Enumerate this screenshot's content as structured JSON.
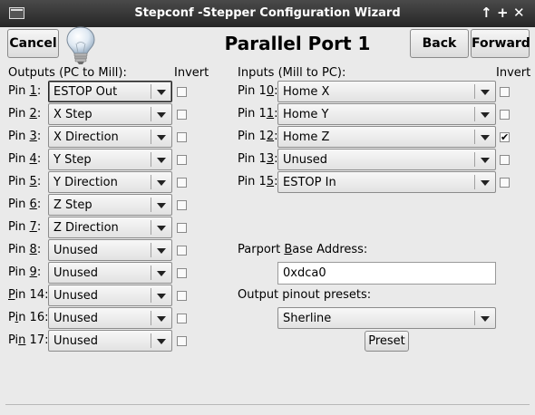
{
  "window": {
    "title": "Stepconf -Stepper Configuration Wizard"
  },
  "titlebar": {
    "restore_glyph": "↑",
    "maximize_glyph": "+",
    "close_glyph": "✕"
  },
  "toolbar": {
    "cancel_label": "Cancel",
    "back_label": "Back",
    "forward_label": "Forward"
  },
  "page": {
    "title": "Parallel Port 1"
  },
  "outputs": {
    "header": "Outputs (PC to Mill):",
    "invert_header": "Invert",
    "pins": [
      {
        "label_pre": "Pin ",
        "label_u": "1",
        "label_post": ":",
        "value": "ESTOP Out",
        "inverted": false
      },
      {
        "label_pre": "Pin ",
        "label_u": "2",
        "label_post": ":",
        "value": "X Step",
        "inverted": false
      },
      {
        "label_pre": "Pin ",
        "label_u": "3",
        "label_post": ":",
        "value": "X Direction",
        "inverted": false
      },
      {
        "label_pre": "Pin ",
        "label_u": "4",
        "label_post": ":",
        "value": "Y Step",
        "inverted": false
      },
      {
        "label_pre": "Pin ",
        "label_u": "5",
        "label_post": ":",
        "value": "Y Direction",
        "inverted": false
      },
      {
        "label_pre": "Pin ",
        "label_u": "6",
        "label_post": ":",
        "value": "Z Step",
        "inverted": false
      },
      {
        "label_pre": "Pin ",
        "label_u": "7",
        "label_post": ":",
        "value": "Z Direction",
        "inverted": false
      },
      {
        "label_pre": "Pin ",
        "label_u": "8",
        "label_post": ":",
        "value": "Unused",
        "inverted": false
      },
      {
        "label_pre": "Pin ",
        "label_u": "9",
        "label_post": ":",
        "value": "Unused",
        "inverted": false
      },
      {
        "label_pre": "",
        "label_u": "P",
        "label_post": "in 14:",
        "value": "Unused",
        "inverted": false
      },
      {
        "label_pre": "P",
        "label_u": "i",
        "label_post": "n 16:",
        "value": "Unused",
        "inverted": false
      },
      {
        "label_pre": "Pi",
        "label_u": "n",
        "label_post": " 17:",
        "value": "Unused",
        "inverted": false
      }
    ]
  },
  "inputs": {
    "header": "Inputs (Mill to PC):",
    "invert_header": "Invert",
    "pins": [
      {
        "label_pre": "Pin 1",
        "label_u": "0",
        "label_post": ":",
        "value": "Home X",
        "inverted": false
      },
      {
        "label_pre": "Pin 1",
        "label_u": "1",
        "label_post": ":",
        "value": "Home Y",
        "inverted": false
      },
      {
        "label_pre": "Pin 1",
        "label_u": "2",
        "label_post": ":",
        "value": "Home Z",
        "inverted": true
      },
      {
        "label_pre": "Pin 1",
        "label_u": "3",
        "label_post": ":",
        "value": "Unused",
        "inverted": false
      },
      {
        "label_pre": "Pin 1",
        "label_u": "5",
        "label_post": ":",
        "value": "ESTOP In",
        "inverted": false
      }
    ]
  },
  "parport": {
    "label_pre": "Parport ",
    "label_u": "B",
    "label_post": "ase Address:",
    "value": "0xdca0"
  },
  "presets": {
    "label": "Output pinout presets:",
    "selected": "Sherline",
    "button_label": "Preset"
  },
  "check_glyph": "✔"
}
